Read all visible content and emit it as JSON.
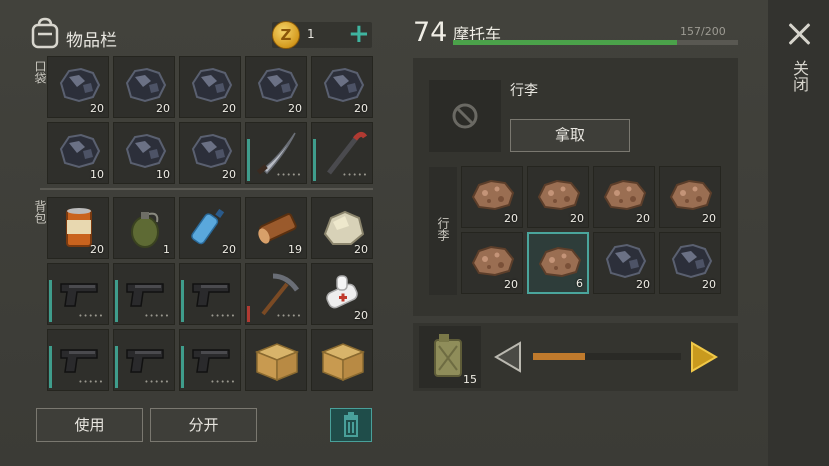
{
  "colors": {
    "accent": "#4aa59c",
    "health_bar": "#4ba24a",
    "slider": "#c07a2c",
    "coin": "#e0a42c"
  },
  "inventory": {
    "title": "物品栏",
    "coins": "1",
    "coin_letter": "Z",
    "plus": "+",
    "pocket_label": "口袋",
    "backpack_label": "背包",
    "pocket": [
      {
        "icon": "coal-ore-icon",
        "qty": "20"
      },
      {
        "icon": "coal-ore-icon",
        "qty": "20"
      },
      {
        "icon": "coal-ore-icon",
        "qty": "20"
      },
      {
        "icon": "coal-ore-icon",
        "qty": "20"
      },
      {
        "icon": "coal-ore-icon",
        "qty": "20"
      },
      {
        "icon": "coal-ore-icon",
        "qty": "10"
      },
      {
        "icon": "coal-ore-icon",
        "qty": "10"
      },
      {
        "icon": "coal-ore-icon",
        "qty": "20"
      },
      {
        "icon": "machete-icon",
        "qty": ""
      },
      {
        "icon": "crowbar-icon",
        "qty": ""
      }
    ],
    "backpack": [
      {
        "icon": "canned-food-icon",
        "qty": "20"
      },
      {
        "icon": "grenade-icon",
        "qty": "1"
      },
      {
        "icon": "water-bottle-icon",
        "qty": "20"
      },
      {
        "icon": "wood-log-icon",
        "qty": "19"
      },
      {
        "icon": "stone-icon",
        "qty": "20"
      },
      {
        "icon": "pistol-icon",
        "qty": ""
      },
      {
        "icon": "pistol-icon",
        "qty": ""
      },
      {
        "icon": "pistol-icon",
        "qty": ""
      },
      {
        "icon": "pickaxe-icon",
        "qty": ""
      },
      {
        "icon": "bandage-icon",
        "qty": "20"
      },
      {
        "icon": "pistol-icon",
        "qty": ""
      },
      {
        "icon": "pistol-icon",
        "qty": ""
      },
      {
        "icon": "pistol-icon",
        "qty": ""
      },
      {
        "icon": "cardboard-box-icon",
        "qty": ""
      },
      {
        "icon": "cardboard-box-icon",
        "qty": ""
      }
    ],
    "use_label": "使用",
    "split_label": "分开"
  },
  "vehicle": {
    "level": "74",
    "name": "摩托车",
    "capacity": "157/200",
    "capacity_fraction": 0.785,
    "trunk_title": "行李",
    "take_label": "拿取",
    "trunk_side_label": "行李",
    "trunk": [
      {
        "icon": "iron-ore-icon",
        "qty": "20"
      },
      {
        "icon": "iron-ore-icon",
        "qty": "20"
      },
      {
        "icon": "iron-ore-icon",
        "qty": "20"
      },
      {
        "icon": "iron-ore-icon",
        "qty": "20"
      },
      {
        "icon": "iron-ore-icon",
        "qty": "20"
      },
      {
        "icon": "iron-ore-icon",
        "qty": "6"
      },
      {
        "icon": "coal-ore-icon",
        "qty": "20"
      },
      {
        "icon": "coal-ore-icon",
        "qty": "20"
      }
    ],
    "fuel_qty": "15",
    "fuel_slider": 0.35
  },
  "close_label": "关闭"
}
